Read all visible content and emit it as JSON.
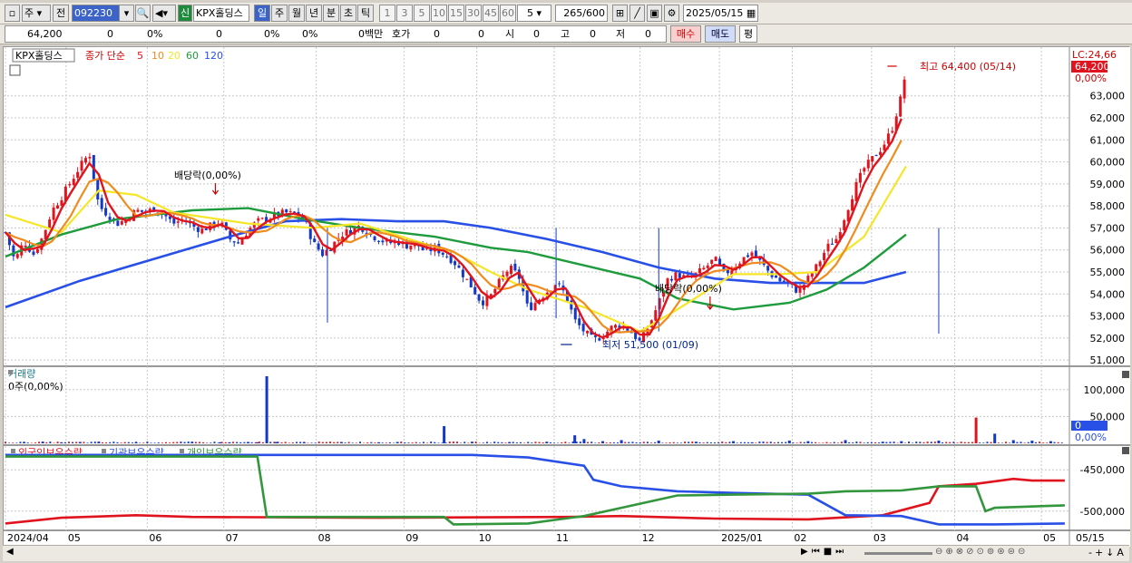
{
  "toolbar": {
    "market_type": "주",
    "prev_label": "전",
    "code": "092230",
    "new_label": "신",
    "stock_name": "KPX홀딩스",
    "period_buttons": [
      "일",
      "주",
      "월",
      "년",
      "분",
      "초",
      "틱"
    ],
    "interval_buttons": [
      "1",
      "3",
      "5",
      "10",
      "15",
      "30",
      "45",
      "60"
    ],
    "interval_value": "5",
    "count": "265",
    "count_max": "/600",
    "date": "2025/05/15"
  },
  "quote": {
    "price": "64,200",
    "change": "0",
    "change_pct": "0%",
    "volume": "0",
    "vol_pct": "0%",
    "pct2": "0%",
    "amount": "0백만",
    "hoga_label": "호가",
    "hoga1": "0",
    "hoga2": "0",
    "open_label": "시",
    "open": "0",
    "high_label": "고",
    "high": "0",
    "low_label": "저",
    "low": "0",
    "buy_label": "매수",
    "sell_label": "매도",
    "eval_label": "평"
  },
  "colors": {
    "up": "#e0141e",
    "down": "#1538c8",
    "ma5": "#e0141e",
    "ma10": "#f08c1e",
    "ma20": "#f5e628",
    "ma60": "#1e9b3c",
    "ma120": "#2850e6",
    "foreign": "#e0141e",
    "institution": "#2850e6",
    "individual": "#32963c"
  },
  "chart_data": [
    {
      "type": "candlestick",
      "legend": {
        "name": "KPX홀딩스",
        "ma_label": "종가 단순",
        "periods": [
          "5",
          "10",
          "20",
          "60",
          "120"
        ]
      },
      "y_ticks": [
        "51,000",
        "52,000",
        "53,000",
        "54,000",
        "55,000",
        "56,000",
        "57,000",
        "58,000",
        "59,000",
        "60,000",
        "61,000",
        "62,000",
        "63,000"
      ],
      "ylim": [
        50800,
        64800
      ],
      "x_labels": [
        "2024/04",
        "05",
        "06",
        "07",
        "08",
        "09",
        "10",
        "11",
        "12",
        "2025/01",
        "02",
        "03",
        "04",
        "05",
        "05/15"
      ],
      "annotations": {
        "high": "최고 64,400 (05/14)",
        "low": "최저 51,500 (01/09)",
        "dividend1": "배당락(0,00%)",
        "dividend2": "배당락(0,00%)",
        "lc": "LC:24,66",
        "last_price": "64,200",
        "last_pct": "0,00%"
      },
      "close_path": [
        [
          0,
          56800
        ],
        [
          10,
          55500
        ],
        [
          20,
          56400
        ],
        [
          30,
          55800
        ],
        [
          40,
          56600
        ],
        [
          50,
          57800
        ],
        [
          60,
          58400
        ],
        [
          70,
          59100
        ],
        [
          80,
          59800
        ],
        [
          90,
          60400
        ],
        [
          95,
          59200
        ],
        [
          100,
          58000
        ],
        [
          110,
          57600
        ],
        [
          120,
          57200
        ],
        [
          130,
          57400
        ],
        [
          140,
          57800
        ],
        [
          150,
          57700
        ],
        [
          160,
          57900
        ],
        [
          170,
          57600
        ],
        [
          180,
          57200
        ],
        [
          190,
          57400
        ],
        [
          200,
          57100
        ],
        [
          210,
          56900
        ],
        [
          220,
          57100
        ],
        [
          230,
          57300
        ],
        [
          240,
          56500
        ],
        [
          250,
          56300
        ],
        [
          260,
          56900
        ],
        [
          270,
          57300
        ],
        [
          280,
          57400
        ],
        [
          290,
          57600
        ],
        [
          300,
          57700
        ],
        [
          310,
          57600
        ],
        [
          320,
          57400
        ],
        [
          330,
          56300
        ],
        [
          340,
          55800
        ],
        [
          350,
          56200
        ],
        [
          360,
          56700
        ],
        [
          370,
          56900
        ],
        [
          380,
          57100
        ],
        [
          390,
          56700
        ],
        [
          400,
          56500
        ],
        [
          410,
          56300
        ],
        [
          420,
          56400
        ],
        [
          430,
          56200
        ],
        [
          440,
          56300
        ],
        [
          450,
          55900
        ],
        [
          460,
          56100
        ],
        [
          470,
          55800
        ],
        [
          480,
          55500
        ],
        [
          490,
          54900
        ],
        [
          500,
          54300
        ],
        [
          510,
          53600
        ],
        [
          520,
          53900
        ],
        [
          530,
          54600
        ],
        [
          540,
          55200
        ],
        [
          550,
          54800
        ],
        [
          560,
          53300
        ],
        [
          570,
          53700
        ],
        [
          580,
          54100
        ],
        [
          590,
          54500
        ],
        [
          600,
          54000
        ],
        [
          610,
          52800
        ],
        [
          620,
          52300
        ],
        [
          630,
          51900
        ],
        [
          640,
          52100
        ],
        [
          650,
          52500
        ],
        [
          660,
          52600
        ],
        [
          670,
          52300
        ],
        [
          680,
          51800
        ],
        [
          690,
          52600
        ],
        [
          700,
          53600
        ],
        [
          710,
          54700
        ],
        [
          720,
          54900
        ],
        [
          730,
          54700
        ],
        [
          740,
          54900
        ],
        [
          750,
          55200
        ],
        [
          760,
          55600
        ],
        [
          770,
          54900
        ],
        [
          780,
          55200
        ],
        [
          790,
          55600
        ],
        [
          800,
          55900
        ],
        [
          810,
          55400
        ],
        [
          820,
          54900
        ],
        [
          830,
          54600
        ],
        [
          840,
          54400
        ],
        [
          850,
          54100
        ],
        [
          860,
          54700
        ],
        [
          870,
          55300
        ],
        [
          880,
          56100
        ],
        [
          890,
          56500
        ],
        [
          900,
          57600
        ],
        [
          910,
          58800
        ],
        [
          920,
          59700
        ],
        [
          930,
          60200
        ],
        [
          940,
          60700
        ],
        [
          950,
          61500
        ],
        [
          960,
          63000
        ],
        [
          965,
          64200
        ]
      ],
      "ma20": [
        [
          0,
          57600
        ],
        [
          60,
          56800
        ],
        [
          100,
          58700
        ],
        [
          140,
          58500
        ],
        [
          180,
          57700
        ],
        [
          260,
          57200
        ],
        [
          330,
          57000
        ],
        [
          380,
          57200
        ],
        [
          440,
          56400
        ],
        [
          480,
          55900
        ],
        [
          520,
          55000
        ],
        [
          560,
          54200
        ],
        [
          620,
          53400
        ],
        [
          680,
          52300
        ],
        [
          720,
          53300
        ],
        [
          780,
          54900
        ],
        [
          830,
          54900
        ],
        [
          870,
          55000
        ],
        [
          920,
          56600
        ],
        [
          965,
          59800
        ]
      ],
      "ma60": [
        [
          0,
          55700
        ],
        [
          60,
          56700
        ],
        [
          120,
          57400
        ],
        [
          200,
          57800
        ],
        [
          260,
          57900
        ],
        [
          320,
          57400
        ],
        [
          380,
          57000
        ],
        [
          460,
          56600
        ],
        [
          520,
          56100
        ],
        [
          560,
          55900
        ],
        [
          620,
          55300
        ],
        [
          680,
          54700
        ],
        [
          720,
          53800
        ],
        [
          780,
          53300
        ],
        [
          840,
          53600
        ],
        [
          880,
          54200
        ],
        [
          920,
          55200
        ],
        [
          965,
          56700
        ]
      ],
      "ma120": [
        [
          0,
          53400
        ],
        [
          80,
          54600
        ],
        [
          160,
          55600
        ],
        [
          240,
          56600
        ],
        [
          300,
          57300
        ],
        [
          360,
          57400
        ],
        [
          420,
          57300
        ],
        [
          470,
          57300
        ],
        [
          520,
          57000
        ],
        [
          580,
          56500
        ],
        [
          640,
          55900
        ],
        [
          700,
          55200
        ],
        [
          760,
          54700
        ],
        [
          820,
          54500
        ],
        [
          880,
          54500
        ],
        [
          920,
          54500
        ],
        [
          965,
          55000
        ]
      ],
      "volume": {
        "y_ticks": [
          "100,000",
          "50,000"
        ],
        "ylim": [
          0,
          130000
        ],
        "label": "거래량",
        "sub_label": "0주(0,00%)",
        "last_value": "0",
        "last_pct": "0,00%",
        "spikes": [
          [
            20,
            1500
          ],
          [
            40,
            3000
          ],
          [
            60,
            2000
          ],
          [
            80,
            2500
          ],
          [
            100,
            3000
          ],
          [
            140,
            2000
          ],
          [
            200,
            2500
          ],
          [
            230,
            2000
          ],
          [
            240,
            2000
          ],
          [
            260,
            2500
          ],
          [
            270,
            2000
          ],
          [
            280,
            125000
          ],
          [
            290,
            2500
          ],
          [
            320,
            2000
          ],
          [
            360,
            2500
          ],
          [
            400,
            2000
          ],
          [
            420,
            2500
          ],
          [
            470,
            32000
          ],
          [
            500,
            3000
          ],
          [
            540,
            2000
          ],
          [
            580,
            3000
          ],
          [
            610,
            15000
          ],
          [
            620,
            8000
          ],
          [
            640,
            4000
          ],
          [
            660,
            6000
          ],
          [
            700,
            5000
          ],
          [
            740,
            3000
          ],
          [
            780,
            4000
          ],
          [
            800,
            2000
          ],
          [
            840,
            5000
          ],
          [
            860,
            4000
          ],
          [
            900,
            6000
          ],
          [
            940,
            3000
          ],
          [
            960,
            4000
          ],
          [
            1000,
            5000
          ],
          [
            1040,
            48000
          ],
          [
            1060,
            18000
          ],
          [
            1080,
            6000
          ],
          [
            1100,
            5000
          ],
          [
            1120,
            4000
          ]
        ]
      },
      "holdings": {
        "series": [
          {
            "name": "외국인보유수량",
            "values": [
              [
                0,
                -515
              ],
              [
                60,
                -508
              ],
              [
                140,
                -505
              ],
              [
                200,
                -507
              ],
              [
                400,
                -508
              ],
              [
                600,
                -507
              ],
              [
                660,
                -506
              ],
              [
                760,
                -509
              ],
              [
                860,
                -510
              ],
              [
                940,
                -505
              ],
              [
                990,
                -490
              ],
              [
                1000,
                -470
              ],
              [
                1040,
                -467
              ],
              [
                1080,
                -461
              ],
              [
                1100,
                -463
              ],
              [
                1135,
                -463
              ]
            ]
          },
          {
            "name": "기관보유수량",
            "values": [
              [
                0,
                -432
              ],
              [
                280,
                -432
              ],
              [
                500,
                -432
              ],
              [
                560,
                -435
              ],
              [
                620,
                -445
              ],
              [
                630,
                -462
              ],
              [
                660,
                -470
              ],
              [
                720,
                -476
              ],
              [
                780,
                -478
              ],
              [
                860,
                -480
              ],
              [
                900,
                -505
              ],
              [
                960,
                -506
              ],
              [
                1000,
                -516
              ],
              [
                1060,
                -516
              ],
              [
                1135,
                -515
              ]
            ]
          },
          {
            "name": "개인보유수량",
            "values": [
              [
                0,
                -434
              ],
              [
                270,
                -434
              ],
              [
                280,
                -507
              ],
              [
                470,
                -507
              ],
              [
                480,
                -516
              ],
              [
                560,
                -515
              ],
              [
                620,
                -506
              ],
              [
                660,
                -496
              ],
              [
                720,
                -481
              ],
              [
                780,
                -480
              ],
              [
                860,
                -479
              ],
              [
                900,
                -476
              ],
              [
                960,
                -475
              ],
              [
                1000,
                -470
              ],
              [
                1040,
                -470
              ],
              [
                1050,
                -500
              ],
              [
                1060,
                -496
              ],
              [
                1135,
                -493
              ]
            ]
          }
        ],
        "y_ticks": [
          "-450,000",
          "-500,000"
        ],
        "ylim": [
          -520,
          -430
        ]
      }
    }
  ]
}
